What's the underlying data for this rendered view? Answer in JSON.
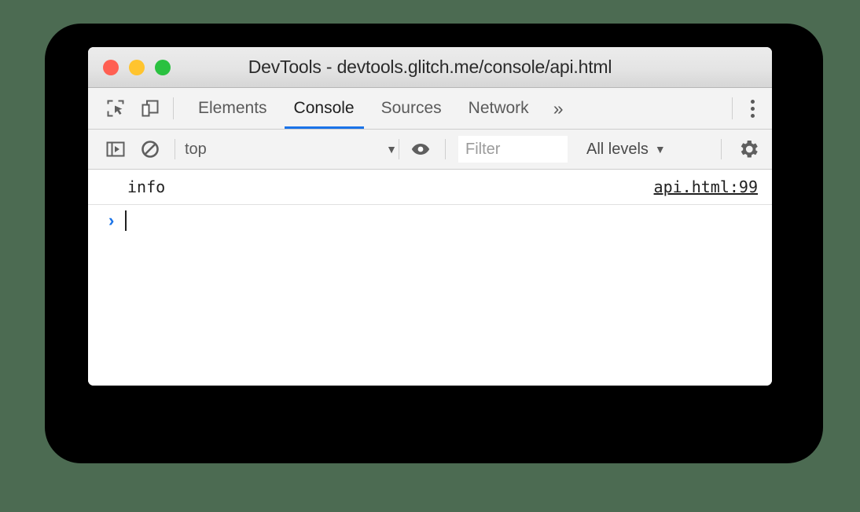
{
  "window": {
    "title": "DevTools - devtools.glitch.me/console/api.html",
    "traffic_lights": [
      {
        "name": "close",
        "color": "#ff5f52"
      },
      {
        "name": "minimize",
        "color": "#ffc42e"
      },
      {
        "name": "maximize",
        "color": "#2ac140"
      }
    ]
  },
  "tabbar": {
    "icons": [
      {
        "name": "inspect-element-icon"
      },
      {
        "name": "device-toolbar-icon"
      }
    ],
    "tabs": [
      {
        "label": "Elements",
        "active": false
      },
      {
        "label": "Console",
        "active": true
      },
      {
        "label": "Sources",
        "active": false
      },
      {
        "label": "Network",
        "active": false
      }
    ],
    "overflow_label": "»",
    "menu_icon": "kebab-menu-icon",
    "active_underline_color": "#1a73e8"
  },
  "console_toolbar": {
    "sidebar_icon": "show-console-sidebar-icon",
    "clear_icon": "clear-console-icon",
    "context_value": "top",
    "context_caret": "▼",
    "eye_icon": "live-expression-eye-icon",
    "filter_placeholder": "Filter",
    "filter_value": "",
    "levels_label": "All levels",
    "levels_caret": "▼",
    "settings_icon": "settings-gear-icon"
  },
  "console": {
    "messages": [
      {
        "text": "info",
        "source": "api.html:99"
      }
    ],
    "prompt": {
      "chevron": "›",
      "input_value": ""
    }
  }
}
